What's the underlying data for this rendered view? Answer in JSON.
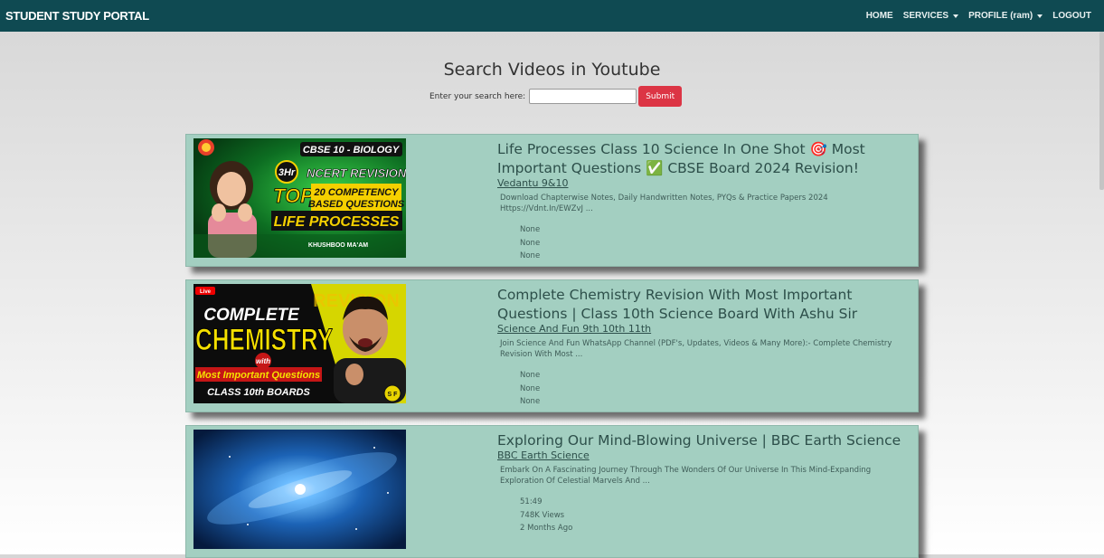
{
  "navbar": {
    "brand": "STUDENT STUDY PORTAL",
    "items": [
      {
        "label": "HOME",
        "dropdown": false
      },
      {
        "label": "SERVICES",
        "dropdown": true
      },
      {
        "label": "PROFILE (ram)",
        "dropdown": true
      },
      {
        "label": "LOGOUT",
        "dropdown": false
      }
    ]
  },
  "search": {
    "title": "Search Videos in Youtube",
    "label": "Enter your search here:",
    "value": "",
    "submit_label": "Submit"
  },
  "results": [
    {
      "title": "Life Processes Class 10 Science In One Shot 🎯 Most Important Questions ✅ CBSE Board 2024 Revision!",
      "channel": "Vedantu 9&10",
      "description": "Download Chapterwise Notes, Daily Handwritten Notes, PYQs & Practice Papers 2024 Https://Vdnt.In/EWZvJ ...",
      "duration": "None",
      "views": "None",
      "published": "None",
      "thumbnail": {
        "banner": "CBSE 10 - BIOLOGY",
        "hours": "3Hr",
        "line1": "NCERT REVISION",
        "top": "TOP",
        "line2": "20 COMPETENCY",
        "line3": "BASED QUESTIONS",
        "topic": "LIFE PROCESSES",
        "presenter": "KHUSHBOO MA'AM"
      }
    },
    {
      "title": "Complete Chemistry Revision With Most Important Questions | Class 10th Science Board With Ashu Sir",
      "channel": "Science And Fun 9th 10th 11th",
      "description": "Join Science And Fun WhatsApp Channel (PDF's, Updates, Videos & Many More):- Complete Chemistry Revision With Most ...",
      "duration": "None",
      "views": "None",
      "published": "None",
      "thumbnail": {
        "live": "Live",
        "line1": "COMPLETE",
        "line2": "CHEMISTRY",
        "with": "with",
        "line3": "Most Important Questions",
        "line4": "CLASS 10th BOARDS",
        "bg": "REVISION",
        "corner": "S F"
      }
    },
    {
      "title": "Exploring Our Mind-Blowing Universe | BBC Earth Science",
      "channel": "BBC Earth Science",
      "description": "Embark On A Fascinating Journey Through The Wonders Of Our Universe In This Mind-Expanding Exploration Of Celestial Marvels And ...",
      "duration": "51:49",
      "views": "748K Views",
      "published": "2 Months Ago"
    }
  ],
  "colors": {
    "navbar": "#0f4a52",
    "card": "#a3cfc1",
    "submit": "#dc3545",
    "text": "#2d4f4a"
  }
}
